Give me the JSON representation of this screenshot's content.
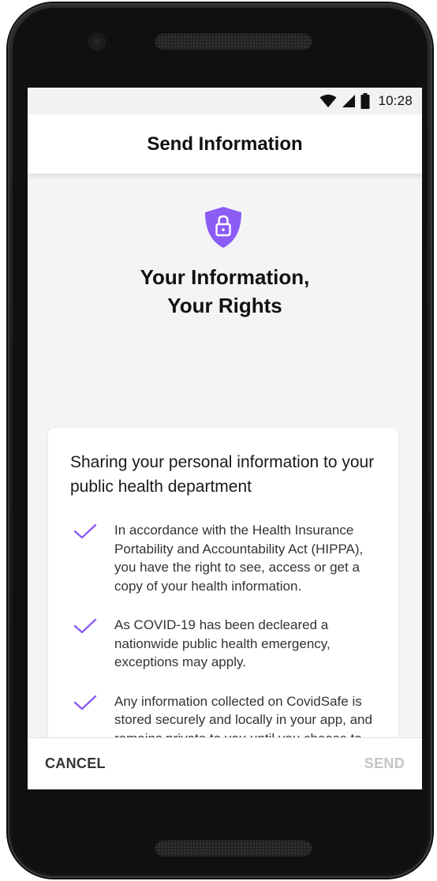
{
  "status_bar": {
    "time": "10:28",
    "icons": [
      "wifi-icon",
      "cell-signal-icon",
      "battery-icon"
    ]
  },
  "header": {
    "title": "Send Information"
  },
  "hero": {
    "icon": "shield-lock-icon",
    "heading_line1": "Your Information,",
    "heading_line2": "Your Rights"
  },
  "card": {
    "title": "Sharing your personal information to your public health department",
    "items": [
      {
        "icon": "check-icon",
        "text": "In accordance with the Health Insurance Portability and Accountability Act (HIPPA), you have the right to see, access or get a copy of your health information."
      },
      {
        "icon": "check-icon",
        "text": "As COVID-19 has been decleared a nationwide public health emergency, exceptions may apply."
      },
      {
        "icon": "check-icon",
        "text": "Any information collected on CovidSafe is stored securely and locally in your app, and remains private to you until you choose to share it with your public health"
      }
    ]
  },
  "footer": {
    "cancel_label": "CANCEL",
    "send_label": "SEND"
  },
  "colors": {
    "accent": "#8b5cf6",
    "send_disabled": "#c4c4c4",
    "background": "#f4f4f6"
  }
}
